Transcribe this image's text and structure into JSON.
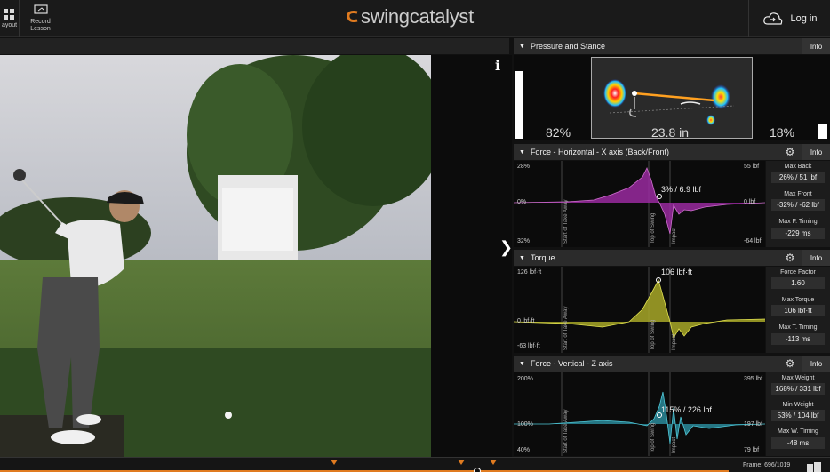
{
  "topbar": {
    "layout_label": "ayout",
    "record_label_line1": "Record",
    "record_label_line2": "Lesson",
    "logo_text": "swingcatalyst",
    "login_label": "Log in"
  },
  "pressure": {
    "title": "Pressure and Stance",
    "info": "Info",
    "left_pct": "82%",
    "stance": "23.8 in",
    "right_pct": "18%"
  },
  "force_x": {
    "title": "Force - Horizontal - X axis (Back/Front)",
    "info": "Info",
    "y_top_left": "28%",
    "y_mid_left": "0%",
    "y_bottom_left": "32%",
    "y_top_right": "55 lbf",
    "y_mid_right": "0 lbf",
    "y_bottom_right": "-64 lbf",
    "annotation": "3% / 6.9 lbf",
    "markers": [
      "Start of Take Away",
      "Top of Swing",
      "Impact"
    ],
    "stats": [
      {
        "label": "Max Back",
        "value": "26% / 51 lbf"
      },
      {
        "label": "Max Front",
        "value": "-32% / -62 lbf"
      },
      {
        "label": "Max F. Timing",
        "value": "-229 ms"
      }
    ]
  },
  "torque": {
    "title": "Torque",
    "info": "Info",
    "y_top_left": "126 lbf·ft",
    "y_mid_left": "0 lbf·ft",
    "y_bottom_left": "-63 lbf·ft",
    "annotation": "106 lbf·ft",
    "markers": [
      "Start of Take Away",
      "Top of Swing",
      "Impact"
    ],
    "stats": [
      {
        "label": "Force Factor",
        "value": "1.60"
      },
      {
        "label": "Max Torque",
        "value": "106 lbf·ft"
      },
      {
        "label": "Max T. Timing",
        "value": "-113 ms"
      }
    ]
  },
  "force_z": {
    "title": "Force - Vertical - Z axis",
    "info": "Info",
    "y_top_left": "200%",
    "y_mid_left": "100%",
    "y_bottom_left": "40%",
    "y_top_right": "395 lbf",
    "y_mid_right": "197 lbf",
    "y_bottom_right": "79 lbf",
    "annotation": "115% / 226 lbf",
    "markers": [
      "Start of Take Away",
      "Top of Swing",
      "Impact"
    ],
    "stats": [
      {
        "label": "Max Weight",
        "value": "168% / 331 lbf"
      },
      {
        "label": "Min Weight",
        "value": "53% / 104 lbf"
      },
      {
        "label": "Max W. Timing",
        "value": "-48 ms"
      }
    ]
  },
  "timeline": {
    "frame_label": "Frame: 696/1019"
  },
  "colors": {
    "accent": "#e07b20",
    "force_x": "#9a2aa0",
    "torque": "#a8a828",
    "force_z": "#2a8a9a"
  }
}
